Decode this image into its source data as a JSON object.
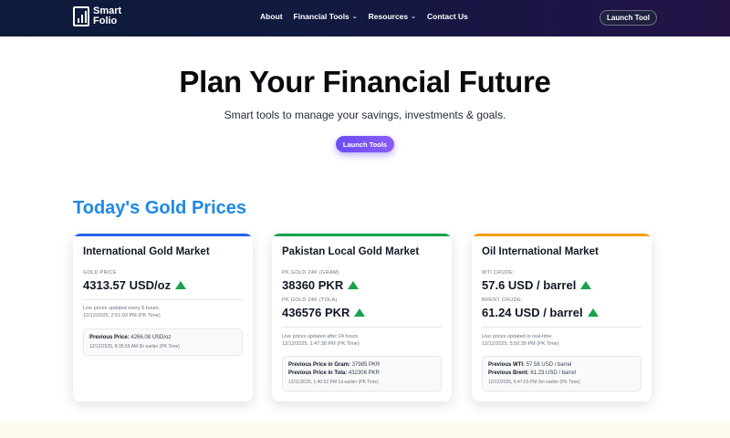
{
  "nav": {
    "logo_line1": "Smart",
    "logo_line2": "Folio",
    "links": [
      {
        "label": "About",
        "dropdown": false
      },
      {
        "label": "Financial Tools",
        "dropdown": true
      },
      {
        "label": "Resources",
        "dropdown": true
      },
      {
        "label": "Contact Us",
        "dropdown": false
      }
    ],
    "cta": "Launch Tool"
  },
  "hero": {
    "title": "Plan Your Financial Future",
    "subtitle": "Smart tools to manage your savings, investments & goals.",
    "button": "Launch Tools"
  },
  "section_title": "Today's Gold Prices",
  "cards": [
    {
      "title": "International Gold Market",
      "accent": "#2563eb",
      "rows": [
        {
          "label": "GOLD PRICE",
          "value": "4313.57 USD/oz",
          "trend": "up"
        }
      ],
      "note_line1": "Live prices updated every 6 hours.",
      "note_line2": "12/12/2025, 2:51:03 PM (PK Time)",
      "prev_lines": [
        {
          "key": "Previous Price:",
          "value": "4266.08 USD/oz"
        }
      ],
      "prev_time": "12/12/2025, 8:35:55 AM 6h earlier (PK Time)"
    },
    {
      "title": "Pakistan Local Gold Market",
      "accent": "#16a34a",
      "rows": [
        {
          "label": "PK GOLD 24K (GRAM)",
          "value": "38360 PKR",
          "trend": "up"
        },
        {
          "label": "PK GOLD 24K (TOLA)",
          "value": "436576 PKR",
          "trend": "up"
        }
      ],
      "note_line1": "Live prices updated after 24 hours.",
      "note_line2": "12/12/2025, 1:47:38 PM (PK Time)",
      "prev_lines": [
        {
          "key": "Previous Price in Gram:",
          "value": "37985 PKR"
        },
        {
          "key": "Previous Price in Tola:",
          "value": "432306 PKR"
        }
      ],
      "prev_time": "12/11/2025, 1:40:52 PM 1d earlier (PK Time)"
    },
    {
      "title": "Oil International Market",
      "accent": "#f59e0b",
      "rows": [
        {
          "label": "WTI CRUDE:",
          "value": "57.6 USD / barrel",
          "trend": "up"
        },
        {
          "label": "BRENT CRUDE:",
          "value": "61.24 USD / barrel",
          "trend": "up"
        }
      ],
      "note_line1": "Live prices updated in real-time",
      "note_line2": "12/12/2025, 5:50:39 PM (PK Time)",
      "prev_lines": [
        {
          "key": "Previous WTI:",
          "value": "57.58 USD / barrel"
        },
        {
          "key": "Previous Brent:",
          "value": "61.23 USD / barrel"
        }
      ],
      "prev_time": "12/12/2025, 5:47:03 PM 3m earlier (PK Time)"
    }
  ]
}
